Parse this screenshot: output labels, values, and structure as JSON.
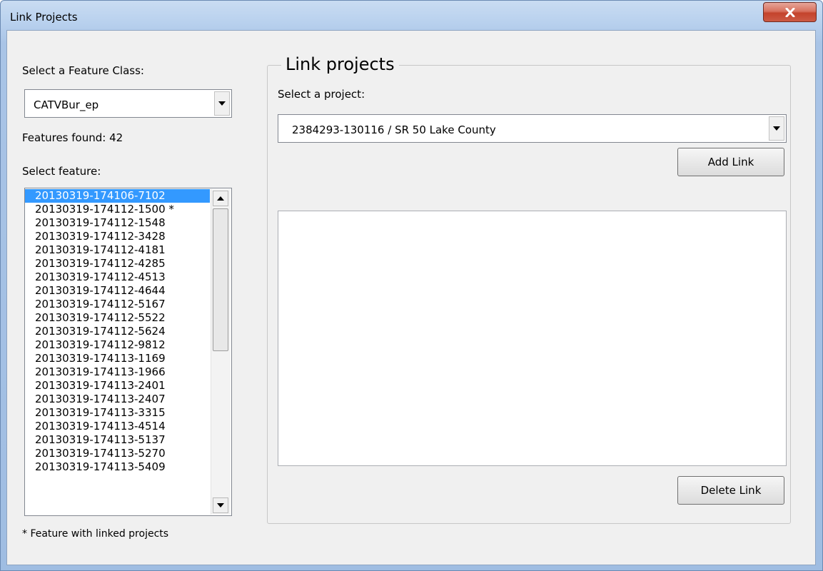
{
  "window": {
    "title": "Link Projects"
  },
  "left": {
    "feature_class_label": "Select a Feature Class:",
    "feature_class_value": "CATVBur_ep",
    "features_found": "Features found: 42",
    "select_feature_label": "Select feature:",
    "features": [
      "20130319-174106-7102",
      "20130319-174112-1500 *",
      "20130319-174112-1548",
      "20130319-174112-3428",
      "20130319-174112-4181",
      "20130319-174112-4285",
      "20130319-174112-4513",
      "20130319-174112-4644",
      "20130319-174112-5167",
      "20130319-174112-5522",
      "20130319-174112-5624",
      "20130319-174112-9812",
      "20130319-174113-1169",
      "20130319-174113-1966",
      "20130319-174113-2401",
      "20130319-174113-2407",
      "20130319-174113-3315",
      "20130319-174113-4514",
      "20130319-174113-5137",
      "20130319-174113-5270",
      "20130319-174113-5409"
    ],
    "selected_feature": "20130319-174106-7102",
    "footnote": "* Feature with linked projects"
  },
  "group": {
    "legend": "Link projects",
    "select_project_label": "Select a project:",
    "project_value": "2384293-130116 / SR 50 Lake County",
    "add_link_label": "Add Link",
    "delete_link_label": "Delete Link"
  },
  "icons": {
    "close": "close-icon",
    "dropdown": "chevron-down-icon",
    "scroll_up": "arrow-up-icon",
    "scroll_down": "arrow-down-icon"
  },
  "colors": {
    "selection": "#3399ff",
    "close_button": "#c4432c"
  }
}
